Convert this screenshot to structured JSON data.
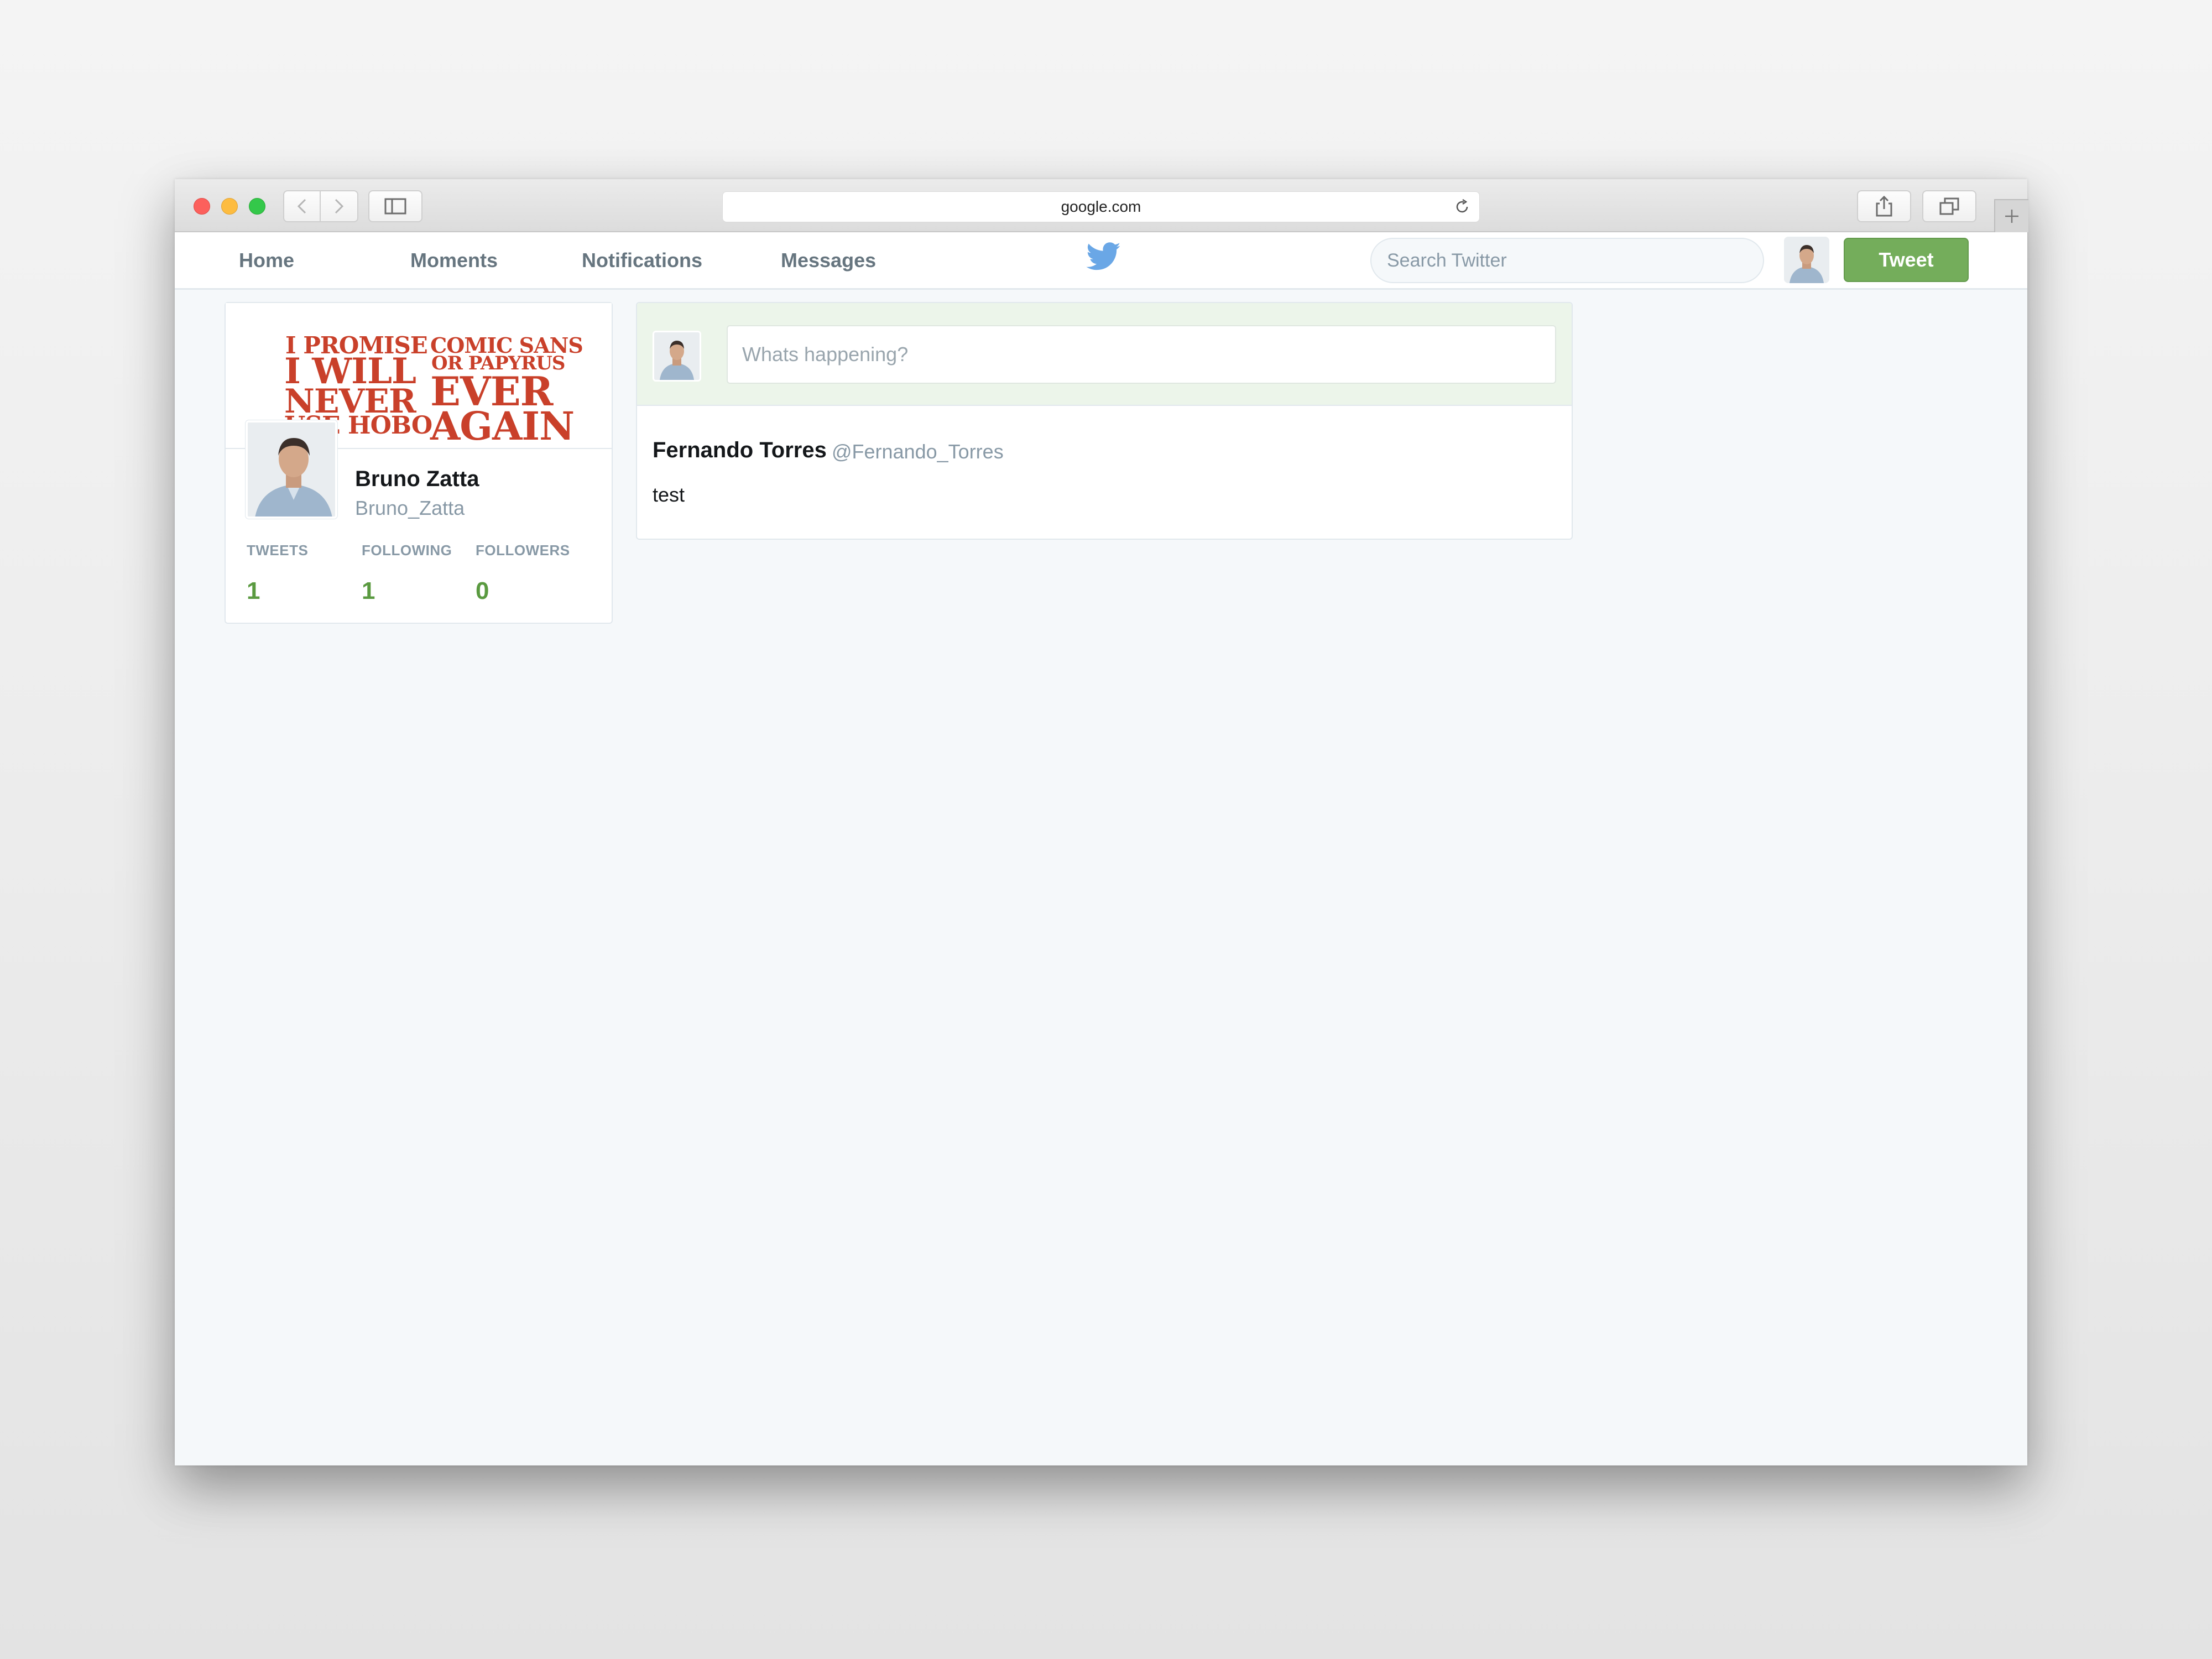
{
  "browser": {
    "address": "google.com"
  },
  "nav": {
    "home": "Home",
    "moments": "Moments",
    "notifications": "Notifications",
    "messages": "Messages",
    "search_placeholder": "Search Twitter",
    "tweet_button": "Tweet"
  },
  "profile": {
    "banner_lines_left": [
      "I PROMISE",
      "I WILL",
      "NEVER",
      "USE HOBO"
    ],
    "banner_lines_right": [
      "COMIC SANS",
      "OR PAPYRUS",
      "EVER",
      "AGAIN"
    ],
    "name": "Bruno Zatta",
    "handle": "Bruno_Zatta",
    "stats": [
      {
        "label": "TWEETS",
        "value": "1"
      },
      {
        "label": "FOLLOWING",
        "value": "1"
      },
      {
        "label": "FOLLOWERS",
        "value": "0"
      }
    ]
  },
  "composer": {
    "placeholder": "Whats happening?"
  },
  "tweets": [
    {
      "author": "Fernando Torres",
      "handle": "@Fernando_Torres",
      "text": "test"
    }
  ],
  "colors": {
    "accent_green": "#74ad5b",
    "twitter_blue": "#55acee",
    "banner_red": "#c9402a"
  }
}
